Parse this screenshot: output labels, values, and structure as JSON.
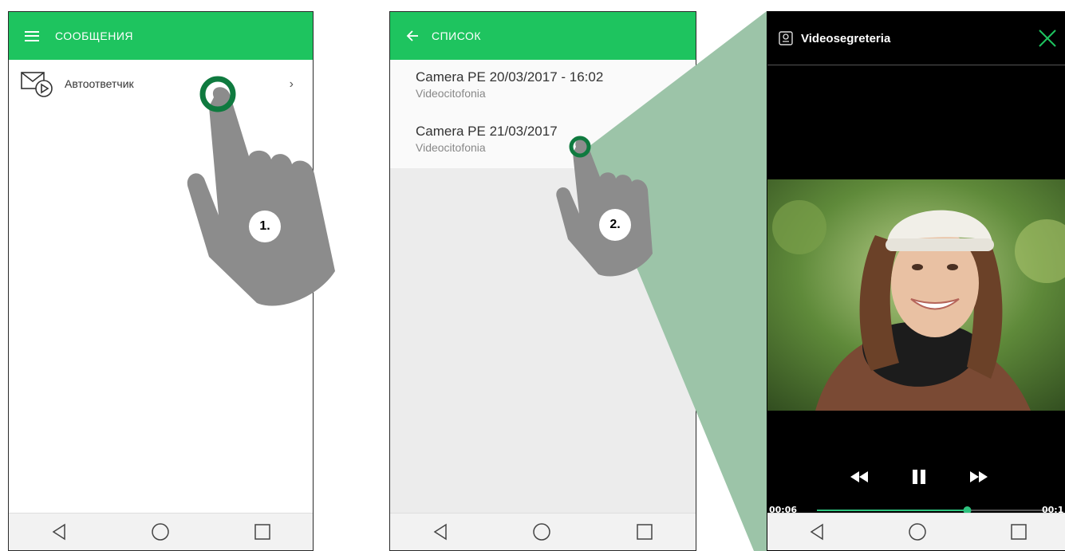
{
  "screen1": {
    "title": "СООБЩЕНИЯ",
    "item_label": "Автоответчик",
    "chevron": "›",
    "step_badge": "1."
  },
  "screen2": {
    "title": "СПИСОК",
    "items": [
      {
        "title": "Camera PE 20/03/2017 - 16:02",
        "subtitle": "Videocitofonia"
      },
      {
        "title": "Camera PE 21/03/2017",
        "subtitle": "Videocitofonia"
      }
    ],
    "step_badge": "2."
  },
  "screen3": {
    "title": "Videosegreteria",
    "time_current": "00:06",
    "time_total": "00:1",
    "progress_fraction": 0.65
  },
  "colors": {
    "accent": "#1ec45f",
    "tap_ring": "#0f7a3f",
    "zoom_fill": "#9cc4a8",
    "hand": "#8c8c8c"
  },
  "icons": {
    "menu": "hamburger-icon",
    "back": "back-arrow-icon",
    "voicemail": "voicemail-icon",
    "camera": "intercom-icon",
    "close": "close-icon",
    "rewind": "rewind-icon",
    "pause": "pause-icon",
    "forward": "fast-forward-icon",
    "nav_back": "nav-back-icon",
    "nav_home": "nav-home-icon",
    "nav_recent": "nav-recent-icon"
  }
}
